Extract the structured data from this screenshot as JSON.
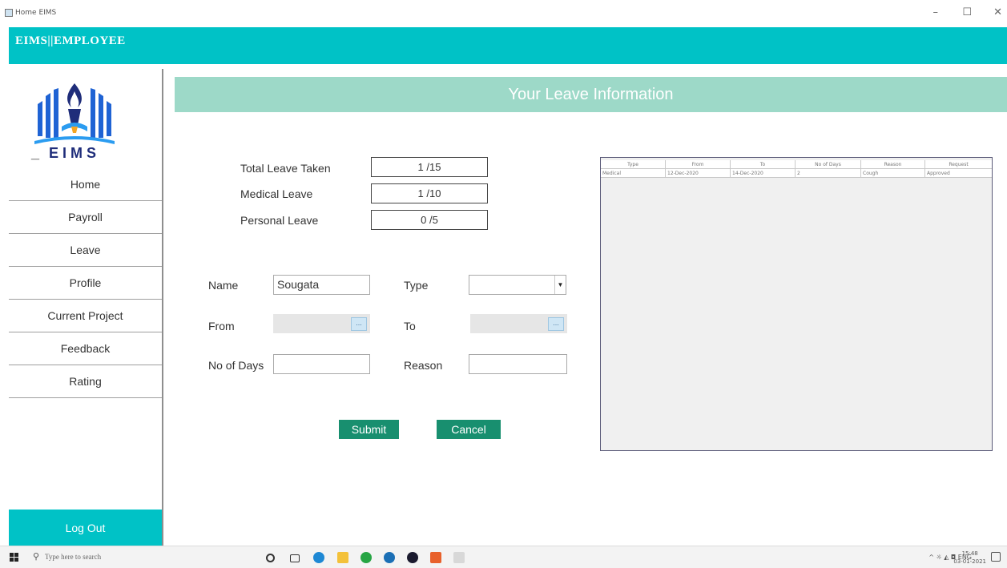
{
  "window": {
    "title": "Home EIMS",
    "controls": {
      "minimize": "–",
      "maximize": "☐",
      "close": "✕"
    }
  },
  "header": {
    "brand": "EIMS||EMPLOYEE"
  },
  "sidebar": {
    "logo_text": "EIMS",
    "logo_prefix": "_",
    "items": [
      {
        "label": "Home"
      },
      {
        "label": "Payroll"
      },
      {
        "label": "Leave"
      },
      {
        "label": "Profile"
      },
      {
        "label": "Current Project"
      },
      {
        "label": "Feedback"
      },
      {
        "label": "Rating"
      }
    ],
    "logout": "Log Out"
  },
  "main": {
    "banner": "Your Leave Information",
    "stats": [
      {
        "label": "Total Leave Taken",
        "value": "1 /15"
      },
      {
        "label": "Medical Leave",
        "value": "1 /10"
      },
      {
        "label": "Personal Leave",
        "value": "0 /5"
      }
    ],
    "form": {
      "name_label": "Name",
      "name_value": "Sougata",
      "type_label": "Type",
      "type_value": "",
      "from_label": "From",
      "to_label": "To",
      "days_label": "No of Days",
      "reason_label": "Reason",
      "date_button": "..."
    },
    "buttons": {
      "submit": "Submit",
      "cancel": "Cancel"
    },
    "table": {
      "headers": [
        "Type",
        "From",
        "To",
        "No of Days",
        "Reason",
        "Request"
      ],
      "rows": [
        [
          "Medical",
          "12-Dec-2020",
          "14-Dec-2020",
          "2",
          "Cough",
          "Approved"
        ]
      ]
    }
  },
  "taskbar": {
    "search_placeholder": "Type here to search",
    "tray_text": "^ ☼ ◭ ◘ ENG",
    "time": "15:48",
    "date": "03-01-2021"
  },
  "colors": {
    "header": "#00c2c6",
    "banner": "#9dd9c8",
    "button": "#188f6f"
  }
}
